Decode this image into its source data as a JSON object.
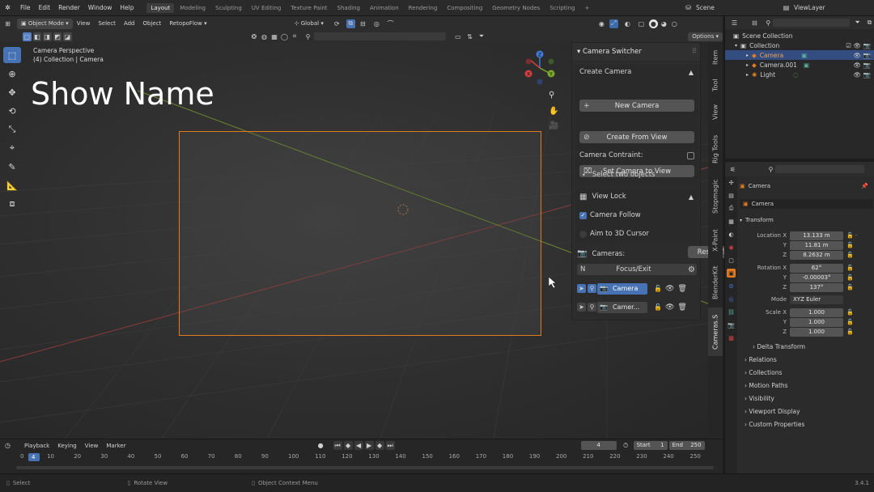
{
  "topmenu": {
    "items": [
      "File",
      "Edit",
      "Render",
      "Window",
      "Help"
    ],
    "workspaces": [
      "Layout",
      "Modeling",
      "Sculpting",
      "UV Editing",
      "Texture Paint",
      "Shading",
      "Animation",
      "Rendering",
      "Compositing",
      "Geometry Nodes",
      "Scripting"
    ],
    "scene": "Scene",
    "view_layer": "ViewLayer"
  },
  "vp_header": {
    "mode": "Object Mode",
    "menus": [
      "View",
      "Select",
      "Add",
      "Object",
      "RetopoFlow"
    ],
    "orientation": "Global",
    "options": "Options"
  },
  "viewport": {
    "overlay_line1": "Camera Perspective",
    "overlay_line2": "(4) Collection | Camera",
    "show_name": "Show Name"
  },
  "npanel": {
    "title": "Camera Switcher",
    "create_camera": {
      "header": "Create Camera",
      "new_camera": "New Camera",
      "create_from_view": "Create From View",
      "set_camera_to_view": "Set Camera to View",
      "constraint_label": "Camera Contraint:",
      "bullet": "Select two objects"
    },
    "view_lock": {
      "header": "View Lock",
      "camera_follow": "Camera Follow",
      "aim_cursor": "Aim to 3D Cursor"
    },
    "cameras_label": "Cameras:",
    "reset_view": "Reset View",
    "focus_key": "N",
    "focus_exit": "Focus/Exit",
    "camera_list": [
      "Camera",
      "Camer..."
    ],
    "tabs": [
      "Item",
      "Tool",
      "View",
      "Rig Tools",
      "Stopmagic",
      "X-Paint",
      "BlenderKit",
      "Cameras.S"
    ]
  },
  "outliner": {
    "root": "Scene Collection",
    "collection": "Collection",
    "items": [
      "Camera",
      "Camera.001",
      "Light"
    ]
  },
  "properties": {
    "object_name": "Camera",
    "data_name": "Camera",
    "transform": "Transform",
    "location": {
      "label": "Location X",
      "x": "13.133 m",
      "y": "11.81 m",
      "z": "8.2632 m"
    },
    "rotation": {
      "label": "Rotation X",
      "x": "62°",
      "y": "-0.00003°",
      "z": "137°"
    },
    "mode_label": "Mode",
    "mode": "XYZ Euler",
    "scale": {
      "label": "Scale X",
      "x": "1.000",
      "y": "1.000",
      "z": "1.000"
    },
    "axis_y": "Y",
    "axis_z": "Z",
    "sections": [
      "Delta Transform",
      "Relations",
      "Collections",
      "Motion Paths",
      "Visibility",
      "Viewport Display",
      "Custom Properties"
    ]
  },
  "timeline": {
    "menus": [
      "Playback",
      "Keying",
      "View",
      "Marker"
    ],
    "current_frame": "4",
    "start_label": "Start",
    "start": "1",
    "end_label": "End",
    "end": "250",
    "ticks": [
      "0",
      "10",
      "20",
      "30",
      "40",
      "50",
      "60",
      "70",
      "80",
      "90",
      "100",
      "110",
      "120",
      "130",
      "140",
      "150",
      "160",
      "170",
      "180",
      "190",
      "200",
      "210",
      "220",
      "230",
      "240",
      "250"
    ]
  },
  "statusbar": {
    "select": "Select",
    "rotate": "Rotate View",
    "context": "Object Context Menu",
    "version": "3.4.1"
  },
  "colors": {
    "accent": "#4772b3",
    "camera_frame": "#e07b21",
    "selected_row": "#334d80"
  }
}
